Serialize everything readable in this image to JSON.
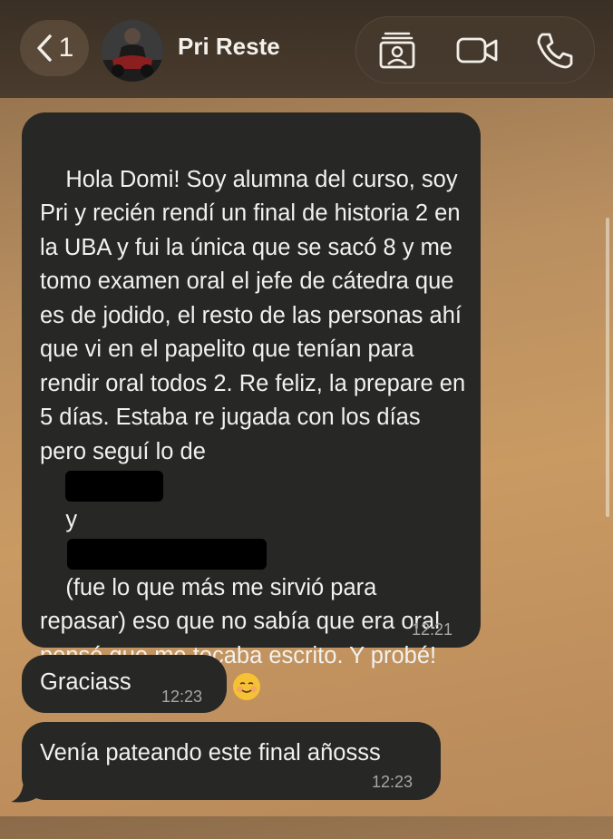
{
  "header": {
    "back_count": "1",
    "contact_name": "Pri Reste"
  },
  "messages": [
    {
      "text_line_1": "Hola Domi! Soy alumna del curso, soy Pri y recién rendí un final de historia 2 en la UBA y fui la única que se sacó 8 y me tomo examen oral el jefe de cátedra que es de jodido, el resto de las personas ahí que vi en el papelito que tenían para rendir oral todos 2. Re feliz, la prepare en 5 días. Estaba re jugada con los días pero seguí lo de",
      "text_connector": "y",
      "text_after": "(fue lo que más me sirvió para repasar) eso que no sabía que era oral pensé que me tocaba escrito. Y probé! Gracias graciasss",
      "emoji": "☺️",
      "time": "12:21"
    },
    {
      "text": "Graciass",
      "time": "12:23"
    },
    {
      "text": "Venía pateando este final añosss",
      "time": "12:23"
    }
  ],
  "icons": {
    "back": "chevron-left-icon",
    "contact_card": "contact-card-icon",
    "video": "video-camera-icon",
    "phone": "phone-icon"
  }
}
